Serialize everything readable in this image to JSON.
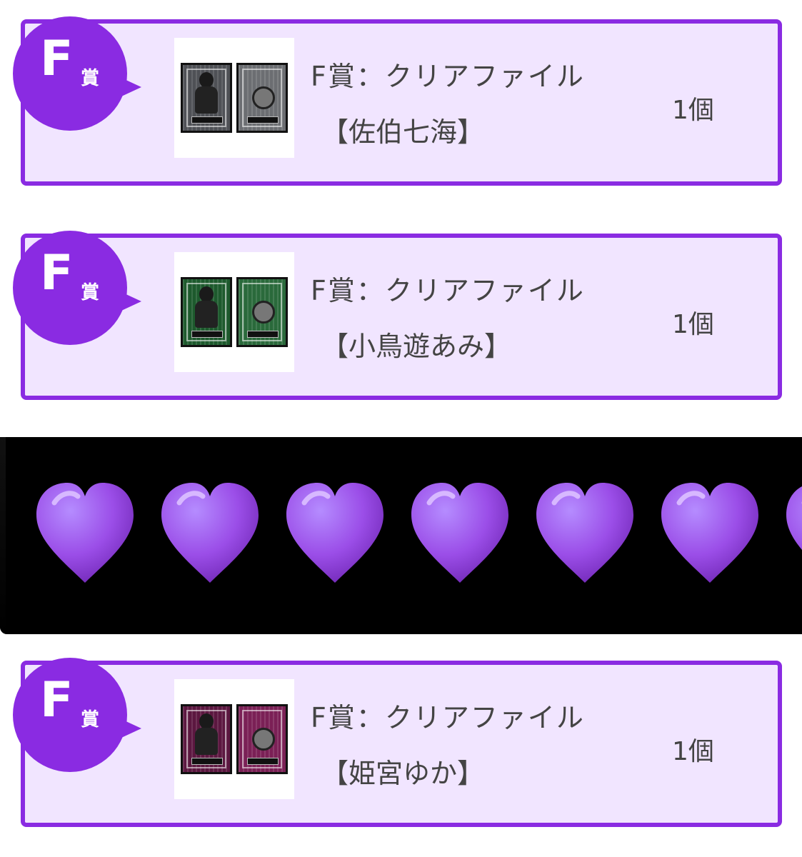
{
  "prizes": [
    {
      "badge_letter": "F",
      "badge_suffix": "賞",
      "title": "F賞：クリアファイル",
      "member": "【佐伯七海】",
      "quantity": "1個",
      "file_color": "#4f5156",
      "file_back_color": "#6c6e72"
    },
    {
      "badge_letter": "F",
      "badge_suffix": "賞",
      "title": "F賞：クリアファイル",
      "member": "【小鳥遊あみ】",
      "quantity": "1個",
      "file_color": "#1d5a2d",
      "file_back_color": "#2a6a3b"
    },
    {
      "badge_letter": "F",
      "badge_suffix": "賞",
      "title": "F賞：クリアファイル",
      "member": "【姫宮ゆか】",
      "quantity": "1個",
      "file_color": "#5c1740",
      "file_back_color": "#7b2056"
    }
  ],
  "divider": {
    "heart_icon": "purple-heart-emoji",
    "heart_count_visible": 7,
    "heart_color": "#9b4ee8",
    "background": "#000000"
  },
  "colors": {
    "accent": "#8a2be2",
    "card_background": "#f1e5ff",
    "text": "#444444"
  }
}
